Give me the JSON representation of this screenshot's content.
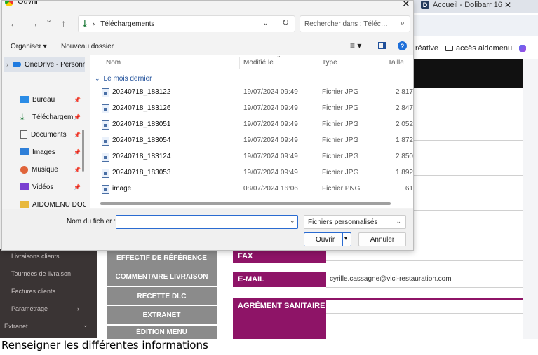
{
  "browser": {
    "tab_title": "Accueil - Dolibarr 16",
    "tab_logo": "D",
    "tab_close": "✕",
    "bookmarks": [
      "réative",
      "accès aidomenu"
    ]
  },
  "app": {
    "sidebar": [
      {
        "label": "Livraisons clients"
      },
      {
        "label": "Tournées de livraison"
      },
      {
        "label": "Factures clients"
      },
      {
        "label": "Paramétrage",
        "chevron": "›"
      },
      {
        "label": "Extranet",
        "chevron": "⌄"
      }
    ],
    "buttons": [
      "EFFECTIF DE RÉFÉRENCE",
      "COMMENTAIRE LIVRAISON",
      "RECETTE DLC",
      "EXTRANET",
      "ÉDITION MENU"
    ],
    "fields": {
      "fax_label": "FAX",
      "email_label": "E-MAIL",
      "email_value": "cyrille.cassagne@vici-restauration.com",
      "agrement_label": "AGRÉMENT SANITAIRE"
    }
  },
  "caption": "Renseigner les différentes informations",
  "dialog": {
    "title": "Ouvrir",
    "close": "✕",
    "nav": {
      "back": "←",
      "forward": "→",
      "recent": "⌄",
      "up": "↑"
    },
    "breadcrumb": {
      "separator": "›",
      "folder": "Téléchargements",
      "dropdown": "⌄",
      "refresh": "↻"
    },
    "search_placeholder": "Rechercher dans : Téléchargements",
    "toolbar": {
      "organize": "Organiser ▾",
      "new_folder": "Nouveau dossier",
      "view": "≡ ▾",
      "help": "?"
    },
    "nav_pane": [
      {
        "label": "OneDrive - Personnel",
        "icon": "cloud-icon",
        "selected": true
      },
      {
        "label": "Bureau",
        "icon": "desktop-icon",
        "pinned": true
      },
      {
        "label": "Téléchargements",
        "icon": "download-icon",
        "pinned": true
      },
      {
        "label": "Documents",
        "icon": "documents-icon",
        "pinned": true
      },
      {
        "label": "Images",
        "icon": "images-icon",
        "pinned": true
      },
      {
        "label": "Musique",
        "icon": "music-icon",
        "pinned": true
      },
      {
        "label": "Vidéos",
        "icon": "videos-icon",
        "pinned": true
      },
      {
        "label": "AIDOMENU DOC",
        "icon": "folder-icon",
        "pinned": false
      }
    ],
    "columns": {
      "name": "Nom",
      "modified": "Modifié le",
      "type": "Type",
      "size": "Taille"
    },
    "group": "Le mois dernier",
    "files": [
      {
        "name": "20240718_183122",
        "modified": "19/07/2024 09:49",
        "type": "Fichier JPG",
        "size": "2 817"
      },
      {
        "name": "20240718_183126",
        "modified": "19/07/2024 09:49",
        "type": "Fichier JPG",
        "size": "2 847"
      },
      {
        "name": "20240718_183051",
        "modified": "19/07/2024 09:49",
        "type": "Fichier JPG",
        "size": "2 052"
      },
      {
        "name": "20240718_183054",
        "modified": "19/07/2024 09:49",
        "type": "Fichier JPG",
        "size": "1 872"
      },
      {
        "name": "20240718_183124",
        "modified": "19/07/2024 09:49",
        "type": "Fichier JPG",
        "size": "2 850"
      },
      {
        "name": "20240718_183053",
        "modified": "19/07/2024 09:49",
        "type": "Fichier JPG",
        "size": "1 892"
      },
      {
        "name": "image",
        "modified": "08/07/2024 16:06",
        "type": "Fichier PNG",
        "size": "61"
      }
    ],
    "filename_label": "Nom du fichier :",
    "filename_value": "",
    "file_type": "Fichiers personnalisés",
    "open_label": "Ouvrir",
    "cancel_label": "Annuler"
  },
  "colors": {
    "accent": "#8e1467",
    "button_gray": "#8b8b8b",
    "sidebar_dark": "#3a3434",
    "dialog_blue": "#2a6bd1"
  }
}
